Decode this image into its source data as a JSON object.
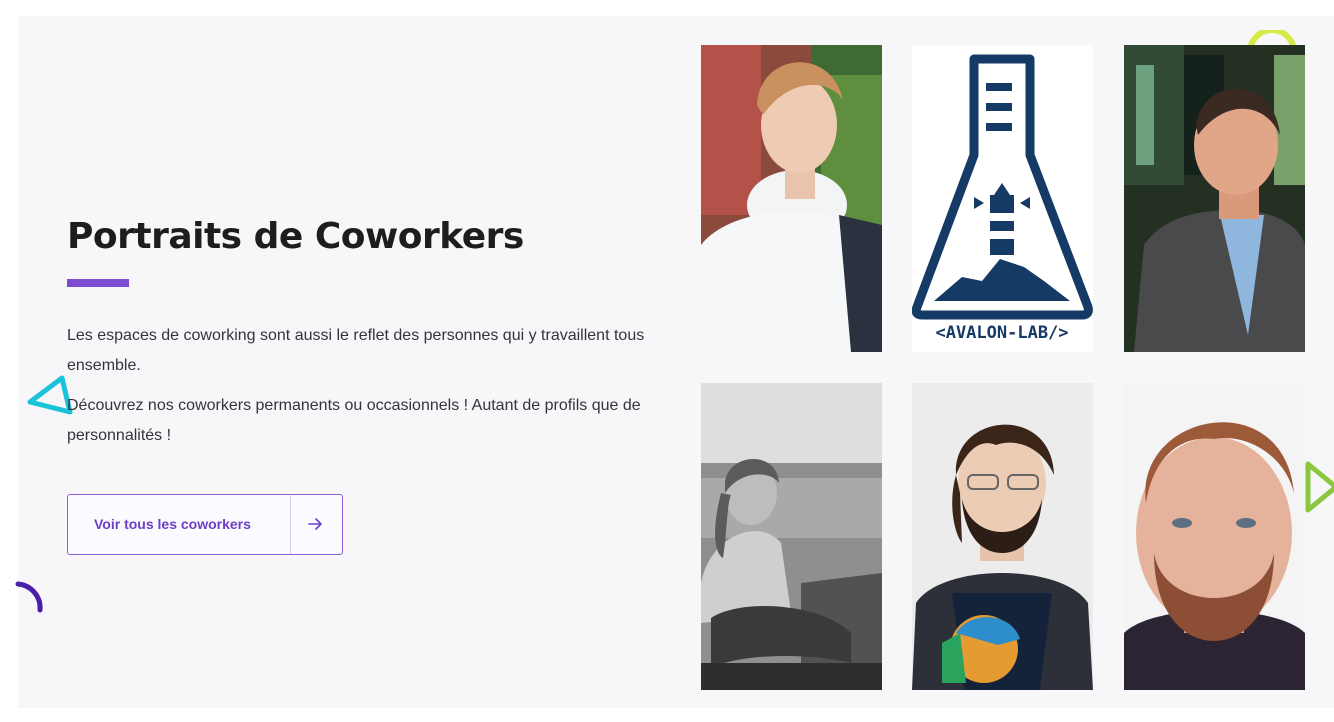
{
  "section": {
    "title": "Portraits de Coworkers",
    "paragraphs": [
      "Les espaces de coworking sont aussi le reflet des personnes qui y travaillent tous ensemble.",
      "Découvrez nos coworkers permanents ou occasionnels ! Autant de profils que de personnalités !"
    ],
    "button_label": "Voir tous les coworkers"
  },
  "portraits": [
    {
      "kind": "photo"
    },
    {
      "kind": "logo",
      "logo_text": "<AVALON-LAB/>"
    },
    {
      "kind": "photo"
    },
    {
      "kind": "photo"
    },
    {
      "kind": "photo"
    },
    {
      "kind": "photo"
    }
  ],
  "colors": {
    "accent": "#7b4ccf",
    "button_text": "#6d3fc4",
    "logo_navy": "#163a66",
    "deco_cyan": "#19c3d8",
    "deco_green": "#8cc63f",
    "deco_purple": "#4a1fa8"
  },
  "icons": {
    "button": "arrow-right-icon",
    "decorations": [
      "triangle-outline-icon",
      "arc-icon",
      "triangle-outline-icon",
      "circle-outline-icon"
    ]
  }
}
